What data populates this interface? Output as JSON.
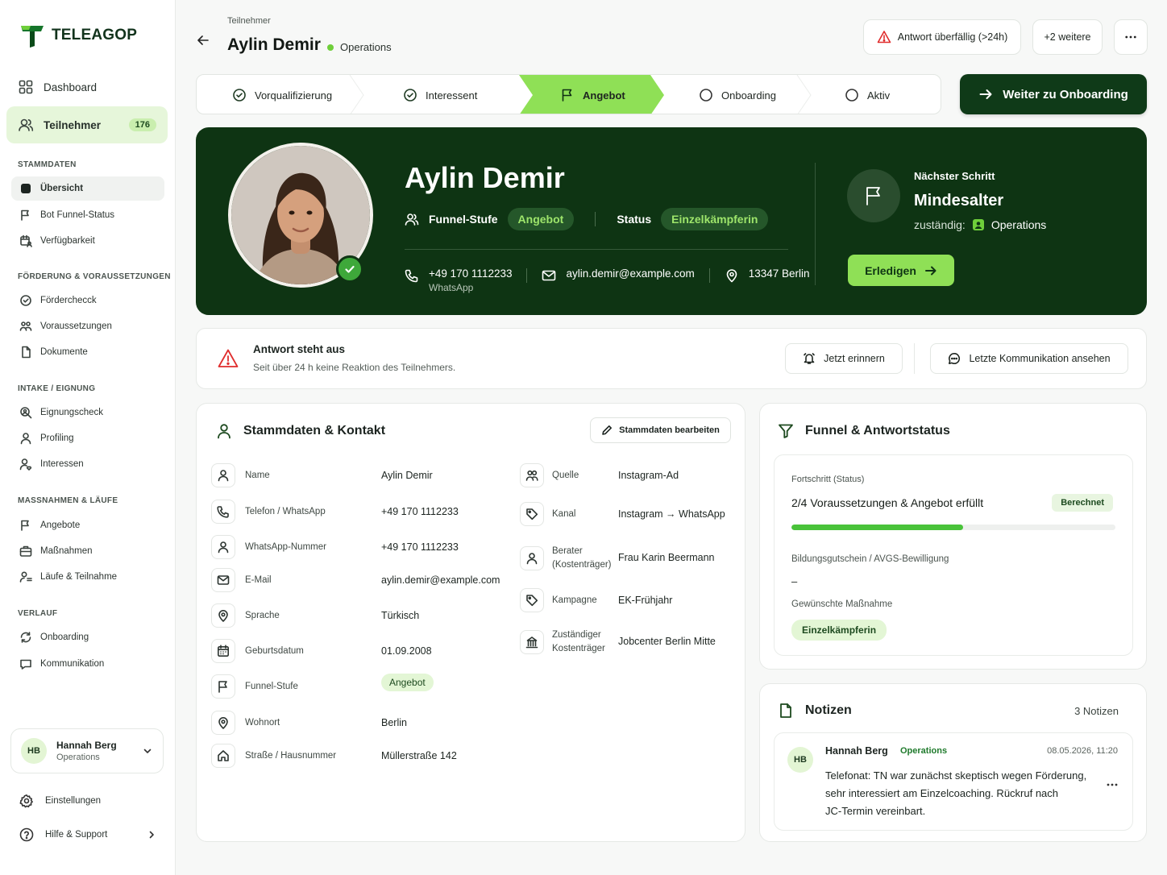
{
  "brand": {
    "name": "TELEAGOP"
  },
  "nav": {
    "main": [
      {
        "label": "Dashboard",
        "icon": "grid-icon"
      },
      {
        "label": "Teilnehmer",
        "icon": "users-icon",
        "badge": "176",
        "active": true
      }
    ],
    "sections": [
      {
        "title": "STAMMDATEN",
        "items": [
          {
            "label": "Übersicht",
            "icon": "dashboard-square-icon",
            "active": true
          },
          {
            "label": "Bot Funnel-Status",
            "icon": "flag-icon"
          },
          {
            "label": "Verfügbarkeit",
            "icon": "calendar-user-icon"
          }
        ]
      },
      {
        "title": "FÖRDERUNG & VORAUSSETZUNGEN",
        "items": [
          {
            "label": "Förderchecck",
            "icon": "check-circle-icon"
          },
          {
            "label": "Voraussetzungen",
            "icon": "users-group-icon"
          },
          {
            "label": "Dokumente",
            "icon": "document-icon"
          }
        ]
      },
      {
        "title": "INTAKE / EIGNUNG",
        "items": [
          {
            "label": "Eignungscheck",
            "icon": "search-user-icon"
          },
          {
            "label": "Profiling",
            "icon": "user-icon"
          },
          {
            "label": "Interessen",
            "icon": "user-heart-icon"
          }
        ]
      },
      {
        "title": "MASSNAHMEN & LÄUFE",
        "items": [
          {
            "label": "Angebote",
            "icon": "flag-icon"
          },
          {
            "label": "Maßnahmen",
            "icon": "briefcase-icon"
          },
          {
            "label": "Läufe & Teilnahme",
            "icon": "user-list-icon"
          }
        ]
      },
      {
        "title": "VERLAUF",
        "items": [
          {
            "label": "Onboarding",
            "icon": "refresh-icon"
          },
          {
            "label": "Kommunikation",
            "icon": "chat-icon"
          }
        ]
      }
    ],
    "user": {
      "initials": "HB",
      "name": "Hannah Berg",
      "role": "Operations"
    },
    "settings": "Einstellungen",
    "help": "Hilfe & Support"
  },
  "header": {
    "breadcrumb": "Teilnehmer",
    "title": "Aylin Demir",
    "team": "Operations",
    "alert_button": "Antwort überfällig (>24h)",
    "more_button": "+2 weitere"
  },
  "stepper": {
    "steps": [
      {
        "label": "Vorqualifizierung",
        "state": "done"
      },
      {
        "label": "Interessent",
        "state": "done"
      },
      {
        "label": "Angebot",
        "state": "current"
      },
      {
        "label": "Onboarding",
        "state": "todo"
      },
      {
        "label": "Aktiv",
        "state": "todo"
      }
    ],
    "cta": "Weiter zu Onboarding"
  },
  "hero": {
    "name": "Aylin Demir",
    "funnel_label": "Funnel-Stufe",
    "funnel_value": "Angebot",
    "status_label": "Status",
    "status_value": "Einzelkämpferin",
    "phone": "+49 170 1112233",
    "phone_sub": "WhatsApp",
    "email": "aylin.demir@example.com",
    "location": "13347 Berlin",
    "next_label": "Nächster Schritt",
    "next_title": "Mindesalter",
    "resp_label": "zuständig:",
    "resp_value": "Operations",
    "done_button": "Erledigen"
  },
  "alert": {
    "title": "Antwort steht aus",
    "subtitle": "Seit über 24 h keine Reaktion des Teilnehmers.",
    "remind_button": "Jetzt erinnern",
    "comm_button": "Letzte Kommunikation ansehen"
  },
  "stammdaten": {
    "title": "Stammdaten & Kontakt",
    "edit_button": "Stammdaten bearbeiten",
    "left": [
      {
        "label": "Name",
        "value": "Aylin Demir",
        "icon": "user-icon"
      },
      {
        "label": "Telefon / WhatsApp",
        "value": "+49 170 1112233",
        "icon": "phone-icon"
      },
      {
        "label": "WhatsApp-Nummer",
        "value": "+49 170 1112233",
        "icon": "user-icon"
      },
      {
        "label": "E-Mail",
        "value": "aylin.demir@example.com",
        "icon": "mail-icon"
      },
      {
        "label": "Sprache",
        "value": "Türkisch",
        "icon": "pin-icon"
      },
      {
        "label": "Geburtsdatum",
        "value": "01.09.2008",
        "icon": "calendar-icon"
      },
      {
        "label": "Funnel-Stufe",
        "value": "Angebot",
        "icon": "flag-icon",
        "pill": true
      },
      {
        "label": "Wohnort",
        "value": "Berlin",
        "icon": "pin-icon"
      },
      {
        "label": "Straße / Hausnummer",
        "value": "Müllerstraße 142",
        "icon": "home-icon"
      }
    ],
    "right": [
      {
        "label": "Quelle",
        "value": "Instagram-Ad",
        "icon": "users-icon"
      },
      {
        "label": "Kanal",
        "value": "Instagram → WhatsApp",
        "icon": "tag-icon"
      },
      {
        "label": "Berater",
        "label2": "(Kostenträger)",
        "value": "Frau Karin Beermann",
        "icon": "user-icon"
      },
      {
        "label": "Kampagne",
        "value": "EK-Frühjahr",
        "icon": "tag-icon"
      },
      {
        "label": "Zuständiger",
        "label2": "Kostenträger",
        "value": "Jobcenter Berlin Mitte",
        "icon": "building-icon"
      }
    ]
  },
  "funnel": {
    "title": "Funnel & Antwortstatus",
    "progress_label": "Fortschritt (Status)",
    "progress_text": "2/4 Voraussetzungen & Angebot erfüllt",
    "progress_badge": "Berechnet",
    "progress_fraction": 0.53,
    "voucher_label": "Bildungsgutschein / AVGS-Bewilligung",
    "voucher_value": "–",
    "measure_label": "Gewünschte Maßnahme",
    "measure_value": "Einzelkämpferin"
  },
  "notes": {
    "title": "Notizen",
    "count": "3 Notizen",
    "items": [
      {
        "initials": "HB",
        "author": "Hannah Berg",
        "team": "Operations",
        "date": "08.05.2026, 11:20",
        "lines": [
          "Telefonat: TN war zunächst skeptisch wegen Förderung,",
          "sehr interessiert am Einzelcoaching. Rückruf nach",
          "JC-Termin vereinbart."
        ]
      }
    ]
  },
  "colors": {
    "brand_dark": "#0e3413",
    "accent": "#8fe056",
    "active_bg": "#e6f6da",
    "alert_red": "#e02d2d"
  }
}
